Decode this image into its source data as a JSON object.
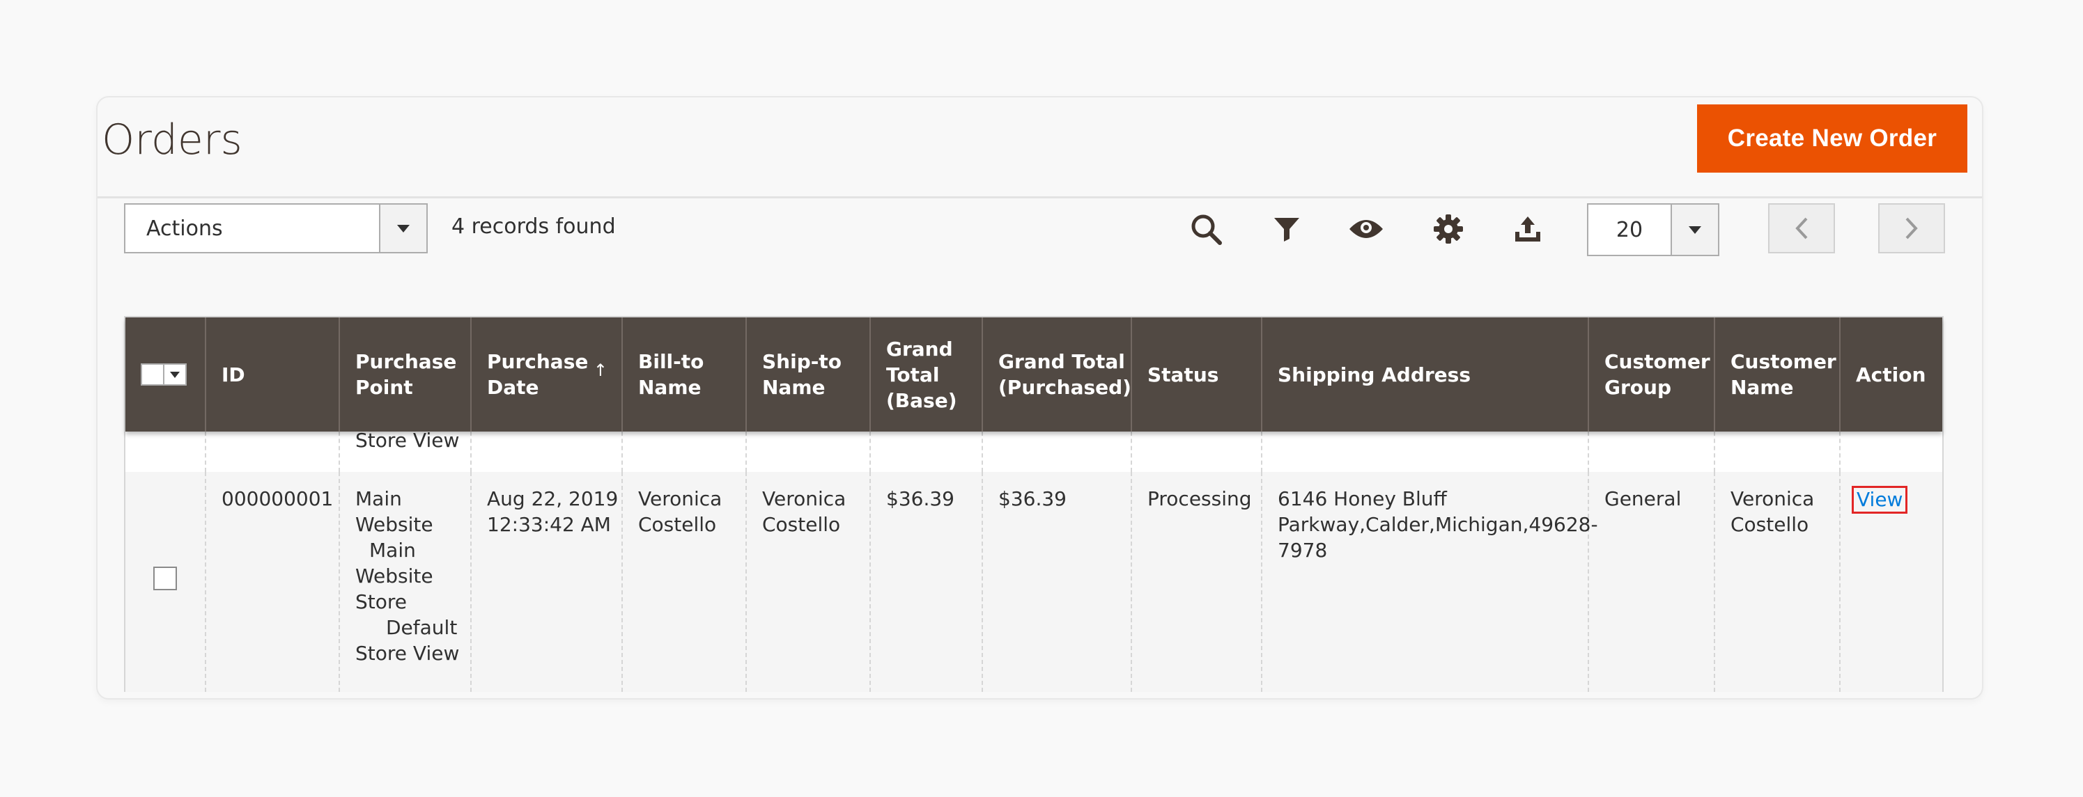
{
  "page": {
    "title": "Orders",
    "create_button": "Create New Order"
  },
  "toolbar": {
    "actions_label": "Actions",
    "records_found": "4 records found",
    "per_page": "20"
  },
  "icons": {
    "search": "search-icon",
    "filter": "filter-icon",
    "columns": "eye-icon",
    "settings": "gear-icon",
    "export": "export-icon",
    "prev": "chevron-left-icon",
    "next": "chevron-right-icon"
  },
  "colors": {
    "accent": "#eb5202",
    "header_bg": "#514943",
    "link": "#007bdb",
    "highlight": "#e22626"
  },
  "columns": [
    {
      "label": "ID"
    },
    {
      "label": "Purchase Point"
    },
    {
      "label": "Purchase Date"
    },
    {
      "label": "Bill-to Name"
    },
    {
      "label": "Ship-to Name"
    },
    {
      "label": "Grand Total (Base)"
    },
    {
      "label": "Grand Total (Purchased)"
    },
    {
      "label": "Status"
    },
    {
      "label": "Shipping Address"
    },
    {
      "label": "Customer Group"
    },
    {
      "label": "Customer Name"
    },
    {
      "label": "Action"
    }
  ],
  "previous_row_fragment": "Store View",
  "row": {
    "id": "000000001",
    "purchase_point_1": "Main",
    "purchase_point_2": "Website",
    "purchase_point_3": "Main",
    "purchase_point_4": "Website",
    "purchase_point_5": "Store",
    "purchase_point_6": "Default",
    "purchase_point_7": "Store View",
    "purchase_date_1": "Aug 22, 2019",
    "purchase_date_2": "12:33:42 AM",
    "bill_to_1": "Veronica",
    "bill_to_2": "Costello",
    "ship_to_1": "Veronica",
    "ship_to_2": "Costello",
    "grand_total_base": "$36.39",
    "grand_total_purchased": "$36.39",
    "status": "Processing",
    "address_1": "6146 Honey Bluff",
    "address_2": "Parkway,Calder,Michigan,49628-",
    "address_3": "7978",
    "customer_group": "General",
    "customer_name_1": "Veronica",
    "customer_name_2": "Costello",
    "action": "View"
  }
}
